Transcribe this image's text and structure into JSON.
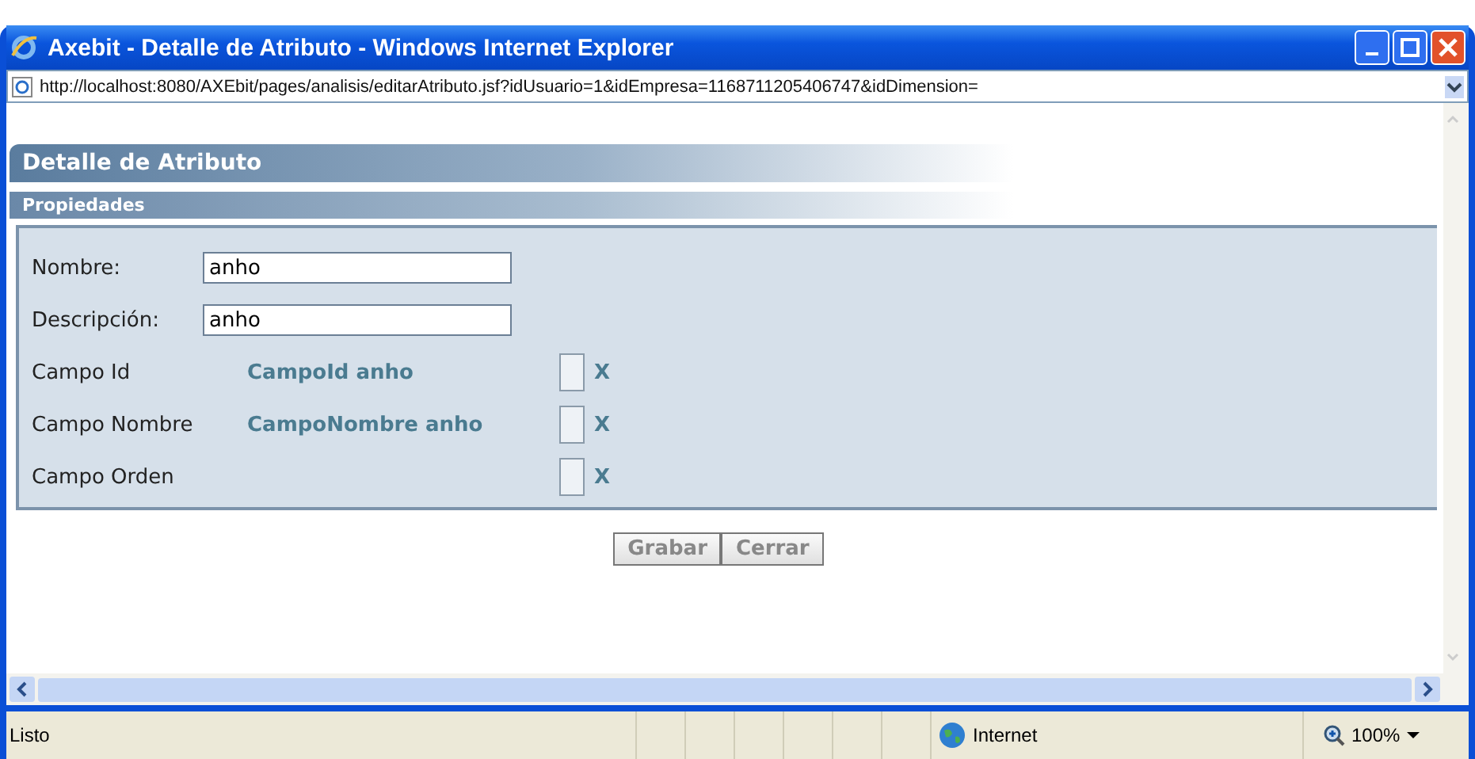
{
  "window": {
    "title": "Axebit - Detalle de Atributo - Windows Internet Explorer"
  },
  "address": "http://localhost:8080/AXEbit/pages/analisis/editarAtributo.jsf?idUsuario=1&idEmpresa=1168711205406747&idDimension=",
  "page": {
    "title": "Detalle de Atributo",
    "section": "Propiedades",
    "fields": [
      {
        "kind": "input",
        "label": "Nombre:",
        "value": "anho"
      },
      {
        "kind": "input",
        "label": "Descripción:",
        "value": "anho"
      },
      {
        "kind": "check",
        "label": "Campo Id",
        "value": "CampoId anho",
        "checked": false,
        "clear": "X"
      },
      {
        "kind": "check",
        "label": "Campo Nombre",
        "value": "CampoNombre anho",
        "checked": false,
        "clear": "X"
      },
      {
        "kind": "check",
        "label": "Campo Orden",
        "checked": false,
        "clear": "X"
      }
    ],
    "buttons": [
      "Grabar",
      "Cerrar"
    ]
  },
  "status_bar": {
    "text": "Listo",
    "zone": "Internet",
    "zoom": "100%"
  }
}
